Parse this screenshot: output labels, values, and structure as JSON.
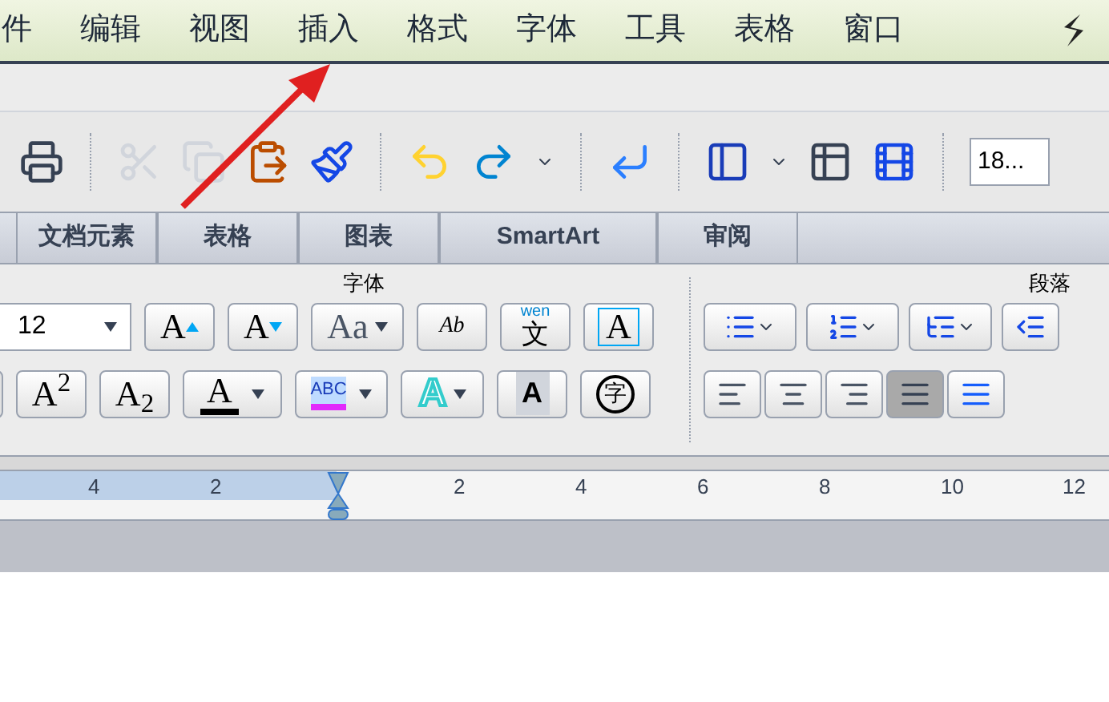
{
  "menu": [
    "件",
    "编辑",
    "视图",
    "插入",
    "格式",
    "字体",
    "工具",
    "表格",
    "窗口"
  ],
  "toolbar": {
    "zoom_value": "18..."
  },
  "ribbon_tabs": [
    {
      "label": "文档元素",
      "selected": false
    },
    {
      "label": "表格",
      "selected": false
    },
    {
      "label": "图表",
      "selected": false
    },
    {
      "label": "SmartArt",
      "selected": false
    },
    {
      "label": "审阅",
      "selected": false
    }
  ],
  "group_labels": {
    "font": "字体",
    "paragraph": "段落"
  },
  "font_size": "12",
  "font_row1": [
    {
      "kind": "grow",
      "label": "A"
    },
    {
      "kind": "shrink",
      "label": "A"
    },
    {
      "kind": "case",
      "label": "Aa"
    },
    {
      "kind": "clear",
      "label": "Ab"
    },
    {
      "kind": "phonetic",
      "label": "文",
      "sup": "wen"
    },
    {
      "kind": "border",
      "label": "A"
    }
  ],
  "font_row2": [
    {
      "kind": "plain",
      "label": "A$^{2}$"
    },
    {
      "kind": "plain",
      "label": "A$_{2}$"
    },
    {
      "kind": "color",
      "label": "A"
    },
    {
      "kind": "highlight",
      "label": "ABC"
    },
    {
      "kind": "effect",
      "label": "A"
    },
    {
      "kind": "shade",
      "label": "A"
    },
    {
      "kind": "enclose",
      "label": "字"
    }
  ],
  "ruler_labels": [
    "4",
    "2",
    "2",
    "4",
    "6",
    "8",
    "10",
    "12"
  ]
}
